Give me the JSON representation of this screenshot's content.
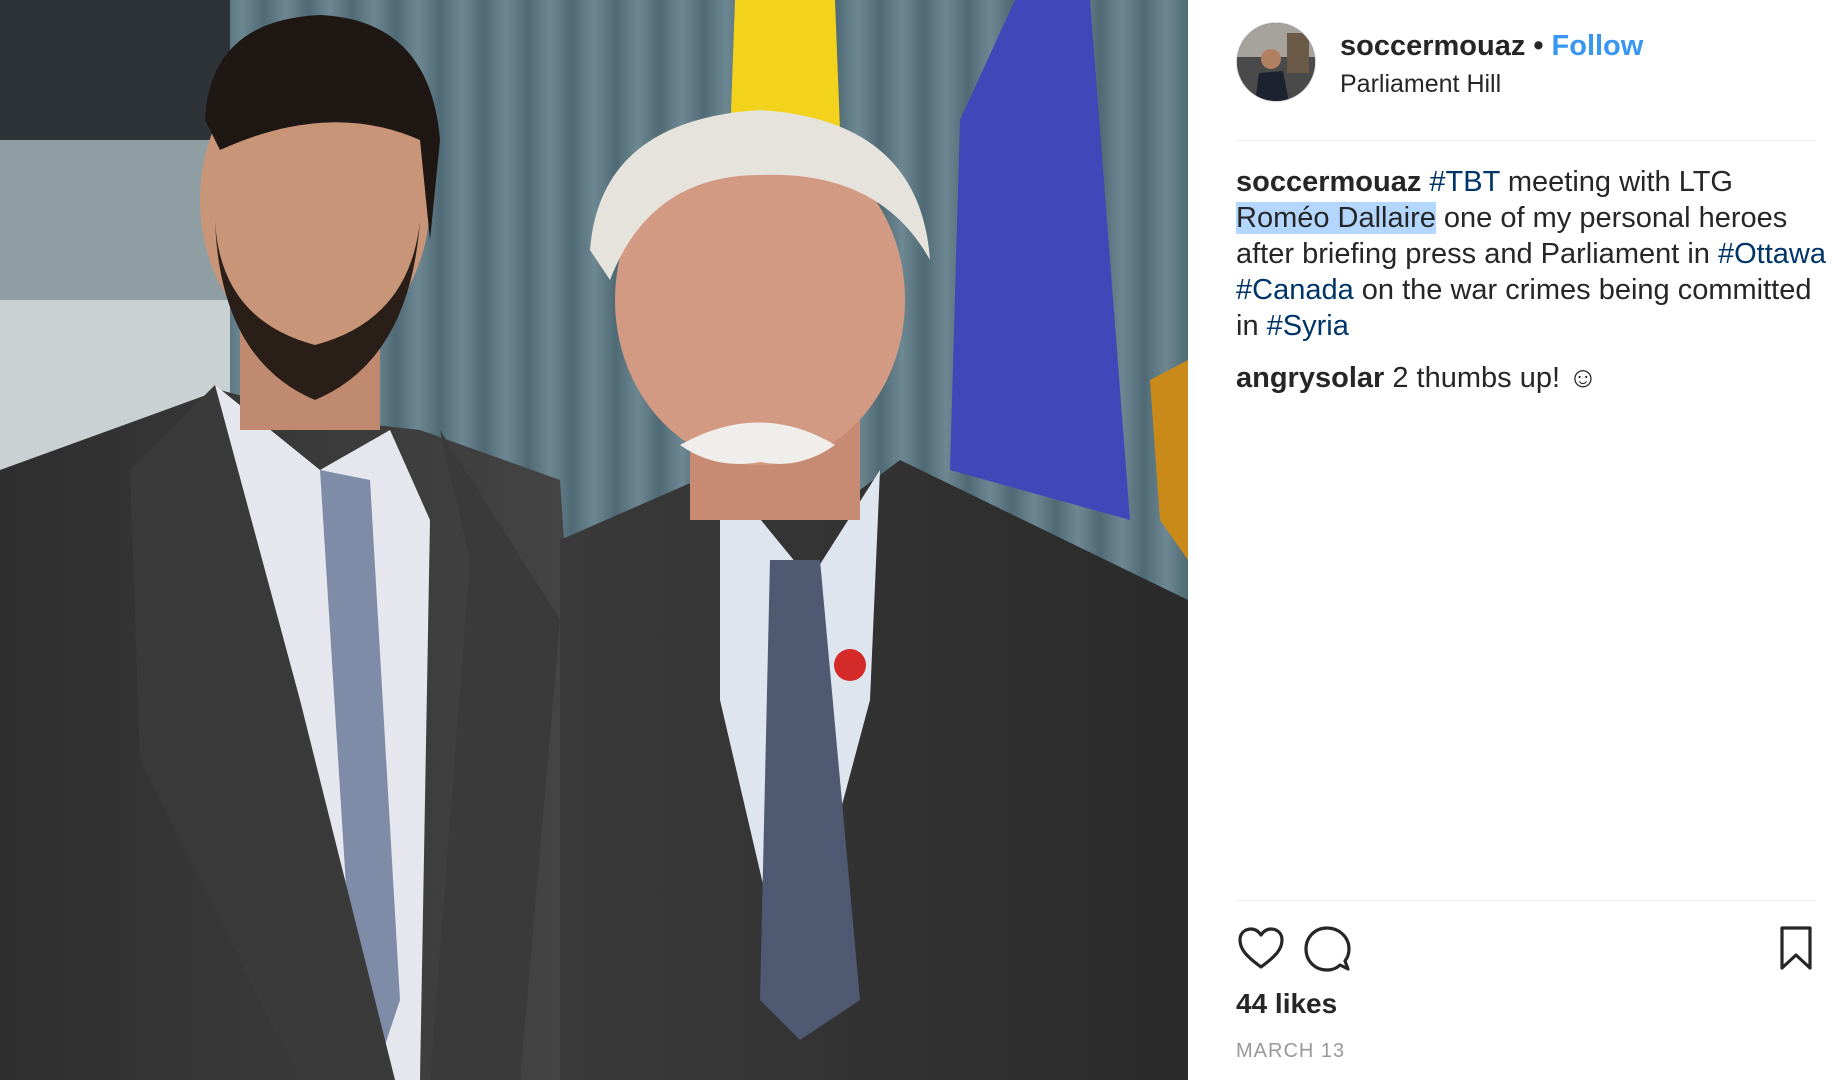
{
  "post": {
    "username": "soccermouaz",
    "separator": "•",
    "follow_label": "Follow",
    "location": "Parliament Hill"
  },
  "caption": {
    "username": "soccermouaz",
    "tag_tbt": "#TBT",
    "text_1": " meeting with LTG ",
    "highlighted": "Roméo Dallaire",
    "text_2": " one of my personal heroes after briefing press and Parliament in ",
    "tag_ottawa": "#Ottawa",
    "space": " ",
    "tag_canada": "#Canada",
    "text_3": " on the war crimes being committed in ",
    "tag_syria": "#Syria"
  },
  "comment": {
    "username": "angrysolar",
    "text": " 2 thumbs up! ☺"
  },
  "stats": {
    "likes": "44 likes",
    "date": "MARCH 13"
  },
  "icons": {
    "like": "heart-icon",
    "comment": "comment-bubble-icon",
    "save": "bookmark-icon"
  },
  "colors": {
    "follow": "#3897f0",
    "hashtag": "#003569",
    "highlight": "#b3d7ff",
    "muted": "#999999"
  }
}
